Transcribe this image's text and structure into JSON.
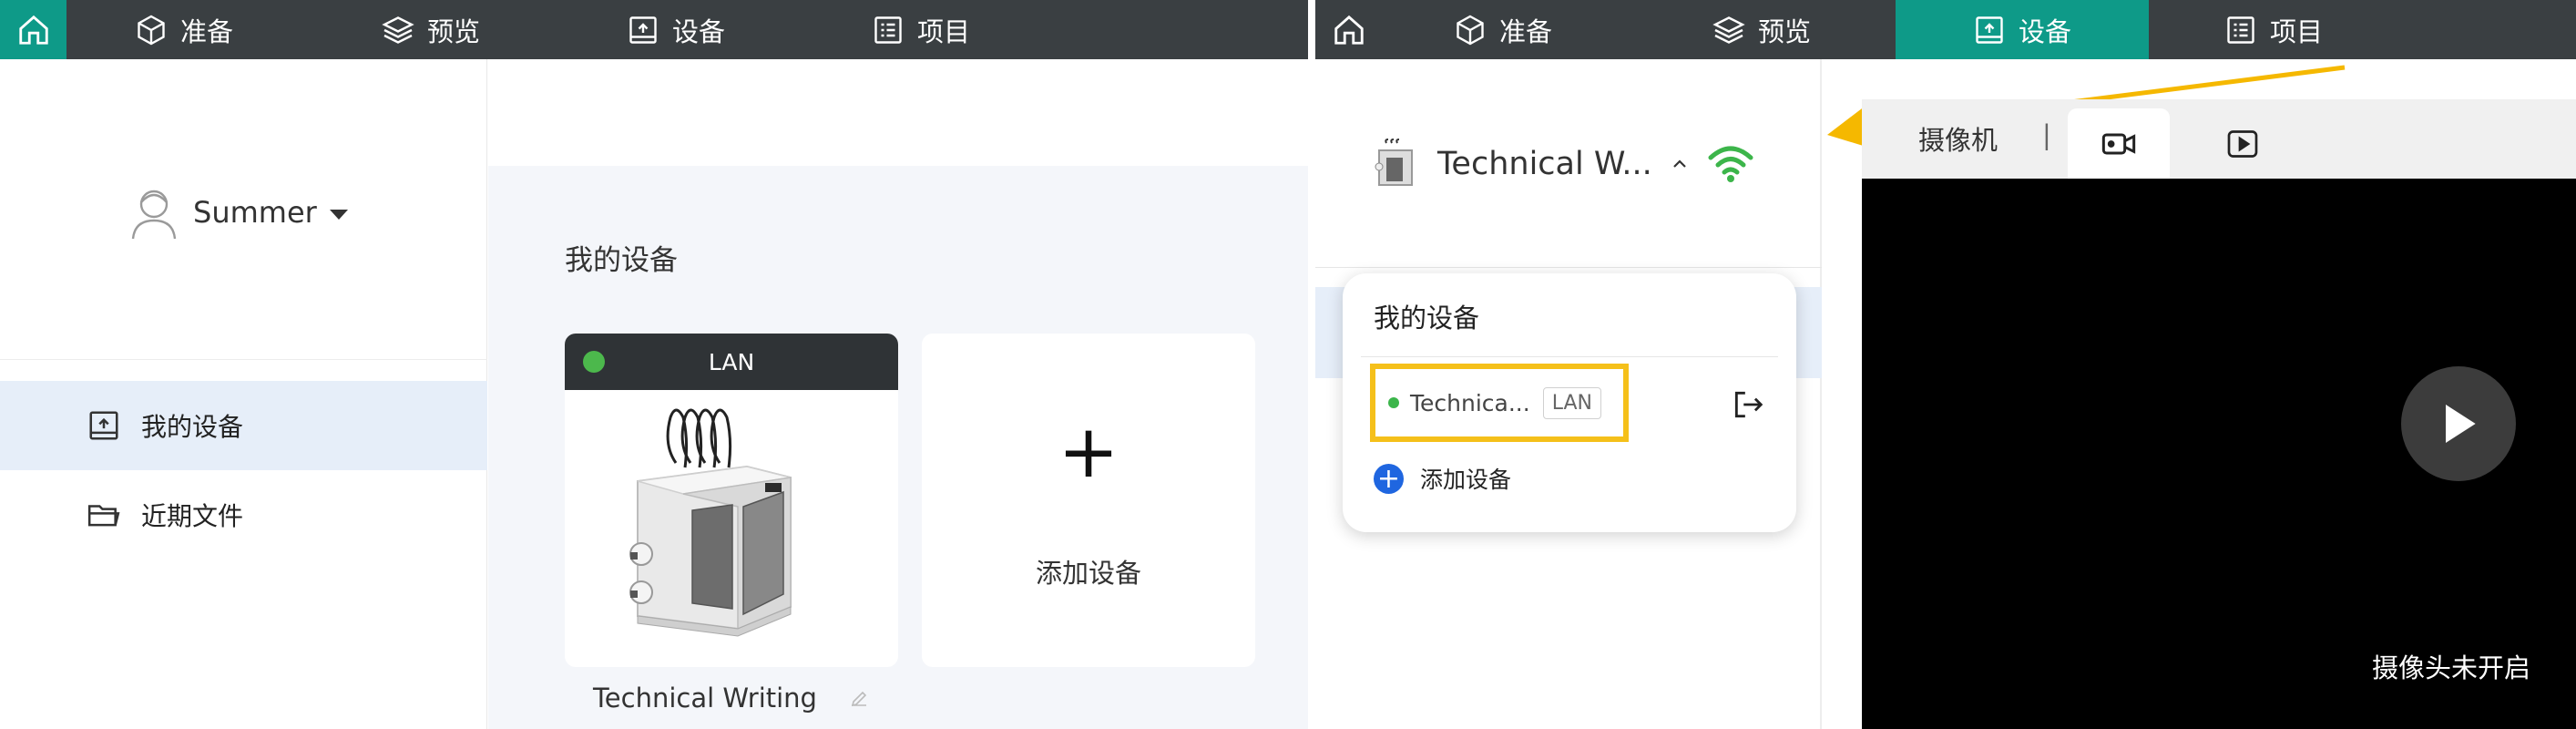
{
  "nav": {
    "items": [
      {
        "label": "准备",
        "icon": "cube-icon"
      },
      {
        "label": "预览",
        "icon": "layers-icon"
      },
      {
        "label": "设备",
        "icon": "device-icon"
      },
      {
        "label": "项目",
        "icon": "list-icon"
      }
    ],
    "colors": {
      "bar": "#3a3f42",
      "active": "#0e9a88"
    }
  },
  "left": {
    "user": {
      "name": "Summer"
    },
    "sidebar": {
      "items": [
        {
          "label": "我的设备",
          "icon": "device-icon",
          "active": true
        },
        {
          "label": "近期文件",
          "icon": "folder-icon",
          "active": false
        }
      ]
    },
    "main": {
      "section_title": "我的设备",
      "device_card": {
        "connection": "LAN",
        "status_color": "#4cb84c",
        "name": "Technical Writing"
      },
      "add_card": {
        "plus": "+",
        "label": "添加设备"
      }
    }
  },
  "right": {
    "device_header": {
      "name": "Technical W..."
    },
    "popup": {
      "title": "我的设备",
      "device": {
        "name": "Technica...",
        "badge": "LAN"
      },
      "add_label": "添加设备"
    },
    "camera": {
      "tab_label": "摄像机",
      "separator": "|",
      "off_text": "摄像头未开启"
    },
    "highlight_color": "#f5c01a",
    "arrow_color": "#f5b800"
  }
}
